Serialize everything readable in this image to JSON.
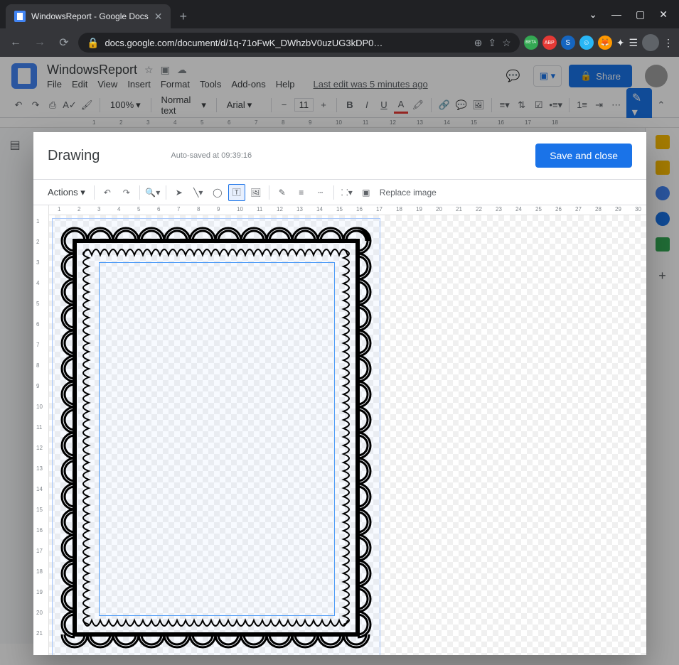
{
  "browser": {
    "tab_title": "WindowsReport - Google Docs",
    "url_display": "docs.google.com/document/d/1q-71oFwK_DWhzbV0uzUG3kDP0…",
    "ext_labels": {
      "beta": "BETA",
      "abp": "ABP",
      "s": "S"
    }
  },
  "docs": {
    "title": "WindowsReport",
    "menu": {
      "file": "File",
      "edit": "Edit",
      "view": "View",
      "insert": "Insert",
      "format": "Format",
      "tools": "Tools",
      "addons": "Add-ons",
      "help": "Help"
    },
    "last_edit": "Last edit was 5 minutes ago",
    "share": "Share",
    "zoom": "100%",
    "style": "Normal text",
    "font": "Arial",
    "font_size": "11"
  },
  "drawing": {
    "title": "Drawing",
    "status": "Auto-saved at 09:39:16",
    "save_close": "Save and close",
    "actions": "Actions",
    "replace": "Replace image"
  },
  "hruler": [
    "1",
    "2",
    "3",
    "4",
    "5",
    "6",
    "7",
    "8",
    "9",
    "10",
    "11",
    "12",
    "13",
    "14",
    "15",
    "16",
    "17",
    "18",
    "19",
    "20",
    "21",
    "22",
    "23",
    "24",
    "25",
    "26",
    "27",
    "28",
    "29",
    "30"
  ],
  "vruler": [
    "1",
    "2",
    "3",
    "4",
    "5",
    "6",
    "7",
    "8",
    "9",
    "10",
    "11",
    "12",
    "13",
    "14",
    "15",
    "16",
    "17",
    "18",
    "19",
    "20",
    "21"
  ],
  "docs_ruler": [
    "1",
    "2",
    "3",
    "4",
    "5",
    "6",
    "7",
    "8",
    "9",
    "10",
    "11",
    "12",
    "13",
    "14",
    "15",
    "16",
    "17",
    "18"
  ]
}
